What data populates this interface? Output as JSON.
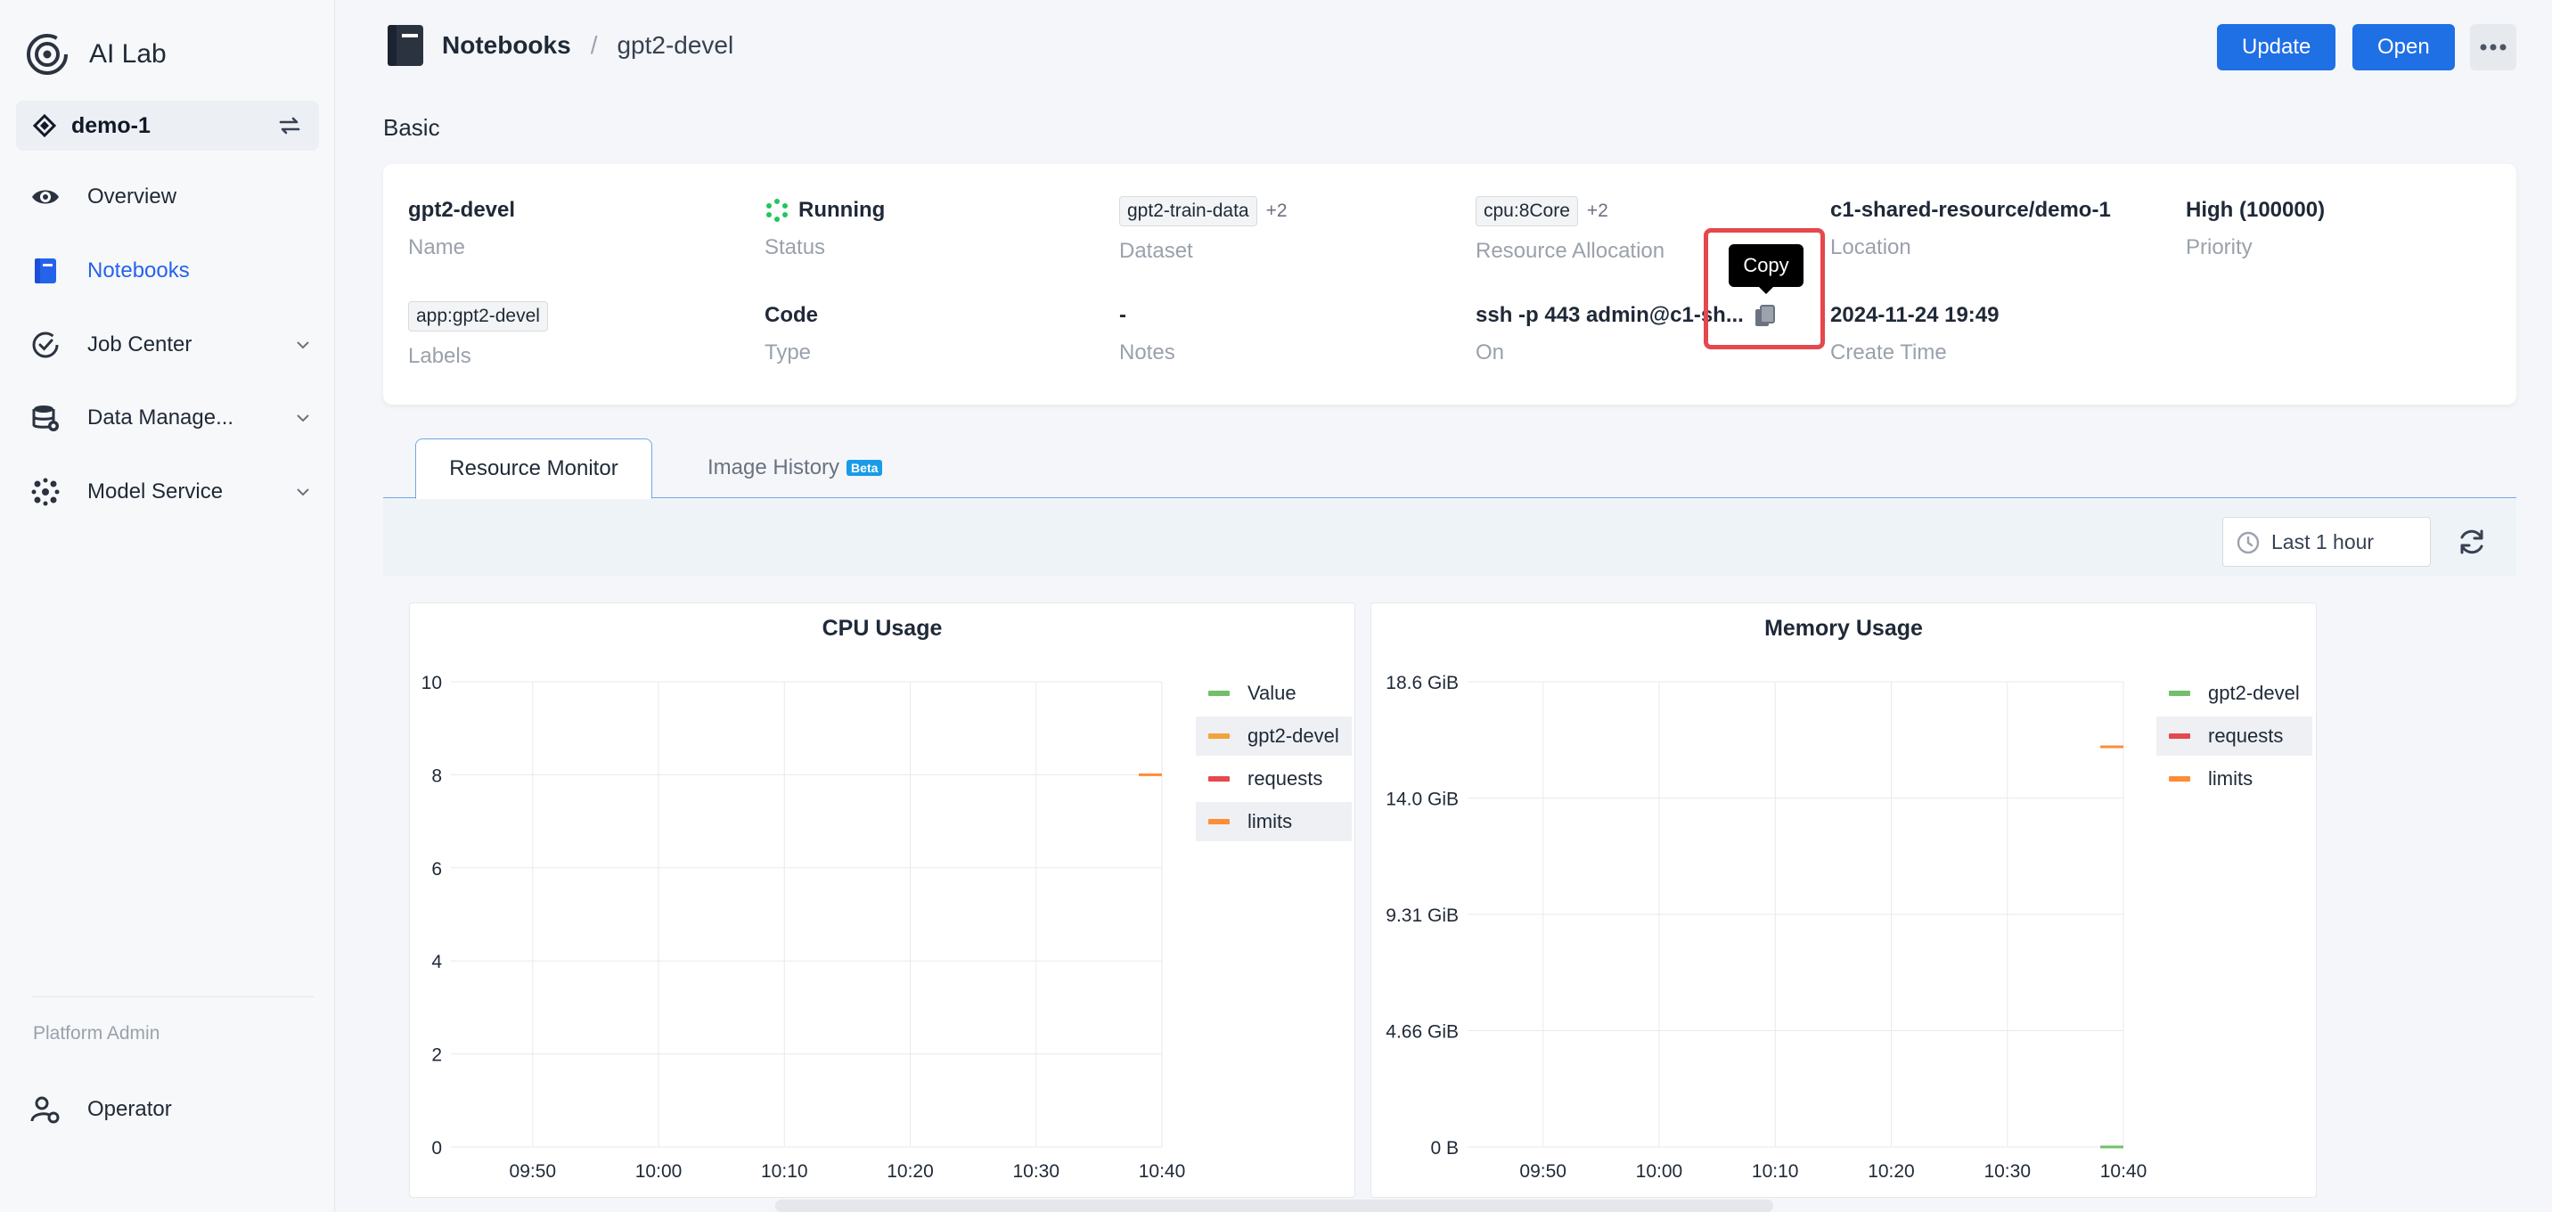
{
  "app": {
    "name": "AI Lab"
  },
  "workspace": {
    "name": "demo-1"
  },
  "sidebar": {
    "items": [
      {
        "label": "Overview"
      },
      {
        "label": "Notebooks"
      },
      {
        "label": "Job Center"
      },
      {
        "label": "Data Manage..."
      },
      {
        "label": "Model Service"
      }
    ],
    "section_label": "Platform Admin",
    "admin_items": [
      {
        "label": "Operator"
      }
    ]
  },
  "breadcrumb": {
    "root": "Notebooks",
    "separator": "/",
    "current": "gpt2-devel"
  },
  "toolbar": {
    "update_label": "Update",
    "open_label": "Open",
    "more_label": "•••"
  },
  "basic": {
    "title": "Basic",
    "fields": {
      "name": {
        "value": "gpt2-devel",
        "label": "Name"
      },
      "status": {
        "value": "Running",
        "label": "Status"
      },
      "dataset": {
        "tag": "gpt2-train-data",
        "more": "+2",
        "label": "Dataset"
      },
      "resource": {
        "tag": "cpu:8Core",
        "more": "+2",
        "label": "Resource Allocation"
      },
      "location": {
        "value": "c1-shared-resource/demo-1",
        "label": "Location"
      },
      "priority": {
        "value": "High (100000)",
        "label": "Priority"
      },
      "labels": {
        "tag": "app:gpt2-devel",
        "label": "Labels"
      },
      "type": {
        "value": "Code",
        "label": "Type"
      },
      "notes": {
        "value": "-",
        "label": "Notes"
      },
      "on": {
        "value": "ssh -p 443 admin@c1-sh...",
        "label": "On"
      },
      "create_time": {
        "value": "2024-11-24 19:49",
        "label": "Create Time"
      }
    },
    "copy_tooltip": "Copy"
  },
  "tabs": [
    {
      "label": "Resource Monitor",
      "active": true
    },
    {
      "label": "Image History",
      "badge": "Beta"
    }
  ],
  "monitor": {
    "time_range": "Last 1 hour"
  },
  "colors": {
    "accent": "#1f6fe5",
    "running": "#22c55e",
    "highlight": "#e5484d"
  },
  "chart_data": [
    {
      "type": "line",
      "title": "CPU Usage",
      "x_ticks": [
        "09:50",
        "10:00",
        "10:10",
        "10:20",
        "10:30",
        "10:40"
      ],
      "y_ticks": [
        "0",
        "2",
        "4",
        "6",
        "8",
        "10"
      ],
      "ylim": [
        0,
        10
      ],
      "series": [
        {
          "name": "Value",
          "color": "#73bf69",
          "points": []
        },
        {
          "name": "gpt2-devel",
          "color": "#f2a33a",
          "points": []
        },
        {
          "name": "requests",
          "color": "#e5484d",
          "points": []
        },
        {
          "name": "limits",
          "color": "#ff8c37",
          "points": [
            {
              "x": "10:40",
              "y": 8
            }
          ]
        }
      ],
      "legend_highlight": [
        "gpt2-devel",
        "limits"
      ]
    },
    {
      "type": "line",
      "title": "Memory Usage",
      "x_ticks": [
        "09:50",
        "10:00",
        "10:10",
        "10:20",
        "10:30",
        "10:40"
      ],
      "y_ticks": [
        "0 B",
        "4.66 GiB",
        "9.31 GiB",
        "14.0 GiB",
        "18.6 GiB"
      ],
      "ylim": [
        0,
        18.6
      ],
      "series": [
        {
          "name": "gpt2-devel",
          "color": "#73bf69",
          "points": [
            {
              "x": "10:40",
              "y": 0
            }
          ]
        },
        {
          "name": "requests",
          "color": "#e5484d",
          "points": []
        },
        {
          "name": "limits",
          "color": "#ff8c37",
          "points": [
            {
              "x": "10:40",
              "y": 16
            }
          ]
        }
      ],
      "legend_highlight": [
        "requests"
      ]
    }
  ]
}
